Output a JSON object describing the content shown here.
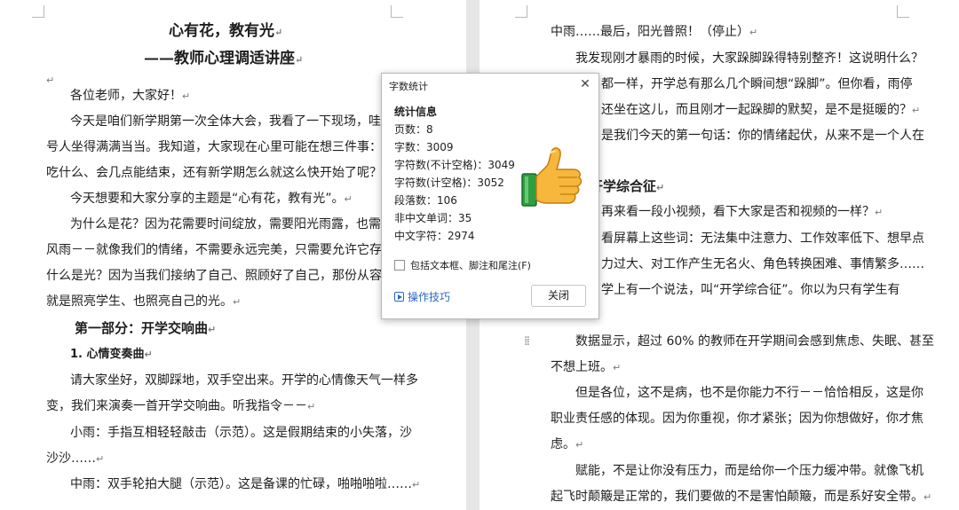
{
  "left_page": {
    "title": "心有花，教有光",
    "subtitle": "——教师心理调适讲座",
    "greeting": "各位老师，大家好！",
    "p1_line1": "今天是咱们新学期第一次全体大会，我看了一下现场，哇，几",
    "p1_line2": "号人坐得满满当当。我知道，大家现在心里可能在想三件事：一会",
    "p1_line3": "吃什么、会几点能结束，还有新学期怎么就这么快开始了呢？",
    "p2_line1": "今天想要和大家分享的主题是“心有花，教有光”。",
    "p3_line1": "为什么是花？因为花需要时间绽放，需要阳光雨露，也需要接",
    "p3_line2": "风雨－－就像我们的情绪，不需要永远完美，只需要允许它存在。",
    "p3_line3": "什么是光？因为当我们接纳了自己、照顾好了自己，那份从容和温",
    "p3_line4": "就是照亮学生、也照亮自己的光。",
    "section1": "第一部分：开学交响曲",
    "sub1": "1. 心情变奏曲",
    "p4_line1": "请大家坐好，双脚踩地，双手空出来。开学的心情像天气一样多",
    "p4_line2": "变，我们来演奏一首开学交响曲。听我指令－－",
    "p5_line1": "小雨：手指互相轻轻敲击（示范）。这是假期结束的小失落，沙",
    "p5_line2": "沙沙……",
    "p6_line1": "中雨：双手轮拍大腿（示范）。这是备课的忙碌，啪啪啪啦……"
  },
  "right_page": {
    "r1": "中雨……最后，阳光普照！（停止）",
    "r2": "我发现刚才暴雨的时候，大家跺脚跺得特别整齐！这说明什么？",
    "r3": "都一样，开学总有那么几个瞬间想“跺脚”。但你看，雨停",
    "r4": "还坐在这儿，而且刚才一起跺脚的默契，是不是挺暖的？",
    "r5": "是我们今天的第一句话：你的情绪起伏，从来不是一个人在",
    "r6": "开学综合征",
    "r7": "再来看一段小视频，看下大家是否和视频的一样？",
    "r8": "看屏幕上这些词：无法集中注意力、工作效率低下、想早点",
    "r9": "力过大、对工作产生无名火、角色转换困难、事情繁多……",
    "r10": "学上有一个说法，叫“开学综合征”。你以为只有学生有",
    "r11": "数据显示，超过 60% 的教师在开学期间会感到焦虑、失眠、甚至",
    "r12": "不想上班。",
    "r13": "但是各位，这不是病，也不是你能力不行－－恰恰相反，这是你",
    "r14": "职业责任感的体现。因为你重视，你才紧张；因为你想做好，你才焦",
    "r15": "虑。",
    "r16": "赋能，不是让你没有压力，而是给你一个压力缓冲带。就像飞机",
    "r17": "起飞时颠簸是正常的，我们要做的不是害怕颠簸，而是系好安全带。"
  },
  "marks": {
    "para": "↵"
  },
  "dialog": {
    "title": "字数统计",
    "heading": "统计信息",
    "pages": "页数：8",
    "words": "字数：3009",
    "chars_no_space": "字符数(不计空格)：3049",
    "chars_with_space": "字符数(计空格)：3052",
    "paragraphs": "段落数：106",
    "non_chinese_words": "非中文单词：35",
    "chinese_chars": "中文字符：2974",
    "checkbox_label": "包括文本框、脚注和尾注(F)",
    "tips_label": "操作技巧",
    "close_label": "关闭",
    "close_x": "✕"
  },
  "colors": {
    "link": "#2a66c4",
    "thumb": "#f6b73c",
    "cuff": "#2e9e3e"
  }
}
